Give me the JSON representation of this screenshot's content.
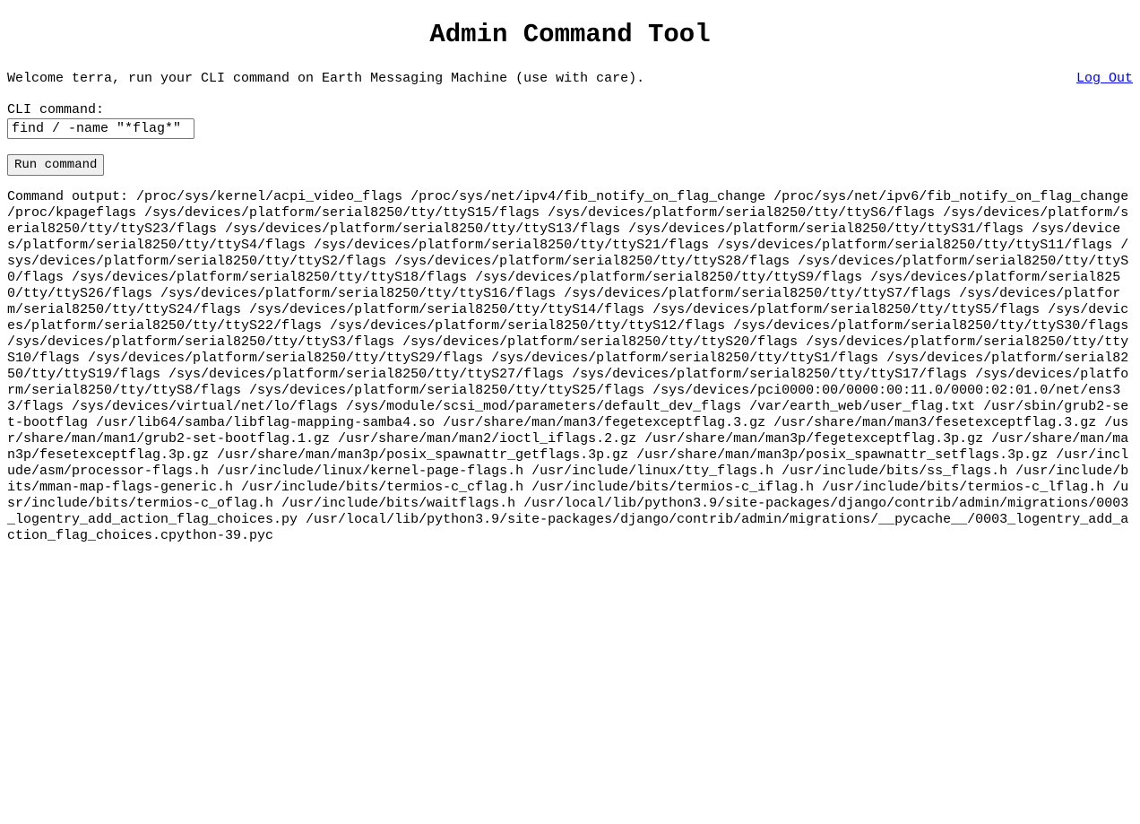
{
  "page": {
    "title": "Admin Command Tool",
    "welcome": "Welcome terra, run your CLI command on Earth Messaging Machine (use with care).",
    "logout_label": "Log Out"
  },
  "form": {
    "cli_label": "CLI command:",
    "cli_value": "find / -name \"*flag*\"",
    "run_label": "Run command"
  },
  "output": {
    "label": "Command output:",
    "text": "/proc/sys/kernel/acpi_video_flags /proc/sys/net/ipv4/fib_notify_on_flag_change /proc/sys/net/ipv6/fib_notify_on_flag_change /proc/kpageflags /sys/devices/platform/serial8250/tty/ttyS15/flags /sys/devices/platform/serial8250/tty/ttyS6/flags /sys/devices/platform/serial8250/tty/ttyS23/flags /sys/devices/platform/serial8250/tty/ttyS13/flags /sys/devices/platform/serial8250/tty/ttyS31/flags /sys/devices/platform/serial8250/tty/ttyS4/flags /sys/devices/platform/serial8250/tty/ttyS21/flags /sys/devices/platform/serial8250/tty/ttyS11/flags /sys/devices/platform/serial8250/tty/ttyS2/flags /sys/devices/platform/serial8250/tty/ttyS28/flags /sys/devices/platform/serial8250/tty/ttyS0/flags /sys/devices/platform/serial8250/tty/ttyS18/flags /sys/devices/platform/serial8250/tty/ttyS9/flags /sys/devices/platform/serial8250/tty/ttyS26/flags /sys/devices/platform/serial8250/tty/ttyS16/flags /sys/devices/platform/serial8250/tty/ttyS7/flags /sys/devices/platform/serial8250/tty/ttyS24/flags /sys/devices/platform/serial8250/tty/ttyS14/flags /sys/devices/platform/serial8250/tty/ttyS5/flags /sys/devices/platform/serial8250/tty/ttyS22/flags /sys/devices/platform/serial8250/tty/ttyS12/flags /sys/devices/platform/serial8250/tty/ttyS30/flags /sys/devices/platform/serial8250/tty/ttyS3/flags /sys/devices/platform/serial8250/tty/ttyS20/flags /sys/devices/platform/serial8250/tty/ttyS10/flags /sys/devices/platform/serial8250/tty/ttyS29/flags /sys/devices/platform/serial8250/tty/ttyS1/flags /sys/devices/platform/serial8250/tty/ttyS19/flags /sys/devices/platform/serial8250/tty/ttyS27/flags /sys/devices/platform/serial8250/tty/ttyS17/flags /sys/devices/platform/serial8250/tty/ttyS8/flags /sys/devices/platform/serial8250/tty/ttyS25/flags /sys/devices/pci0000:00/0000:00:11.0/0000:02:01.0/net/ens33/flags /sys/devices/virtual/net/lo/flags /sys/module/scsi_mod/parameters/default_dev_flags /var/earth_web/user_flag.txt /usr/sbin/grub2-set-bootflag /usr/lib64/samba/libflag-mapping-samba4.so /usr/share/man/man3/fegetexceptflag.3.gz /usr/share/man/man3/fesetexceptflag.3.gz /usr/share/man/man1/grub2-set-bootflag.1.gz /usr/share/man/man2/ioctl_iflags.2.gz /usr/share/man/man3p/fegetexceptflag.3p.gz /usr/share/man/man3p/fesetexceptflag.3p.gz /usr/share/man/man3p/posix_spawnattr_getflags.3p.gz /usr/share/man/man3p/posix_spawnattr_setflags.3p.gz /usr/include/asm/processor-flags.h /usr/include/linux/kernel-page-flags.h /usr/include/linux/tty_flags.h /usr/include/bits/ss_flags.h /usr/include/bits/mman-map-flags-generic.h /usr/include/bits/termios-c_cflag.h /usr/include/bits/termios-c_iflag.h /usr/include/bits/termios-c_lflag.h /usr/include/bits/termios-c_oflag.h /usr/include/bits/waitflags.h /usr/local/lib/python3.9/site-packages/django/contrib/admin/migrations/0003_logentry_add_action_flag_choices.py /usr/local/lib/python3.9/site-packages/django/contrib/admin/migrations/__pycache__/0003_logentry_add_action_flag_choices.cpython-39.pyc"
  },
  "colors": {
    "link": "#0000ee",
    "button_bg": "#efefef",
    "border": "#767676"
  }
}
